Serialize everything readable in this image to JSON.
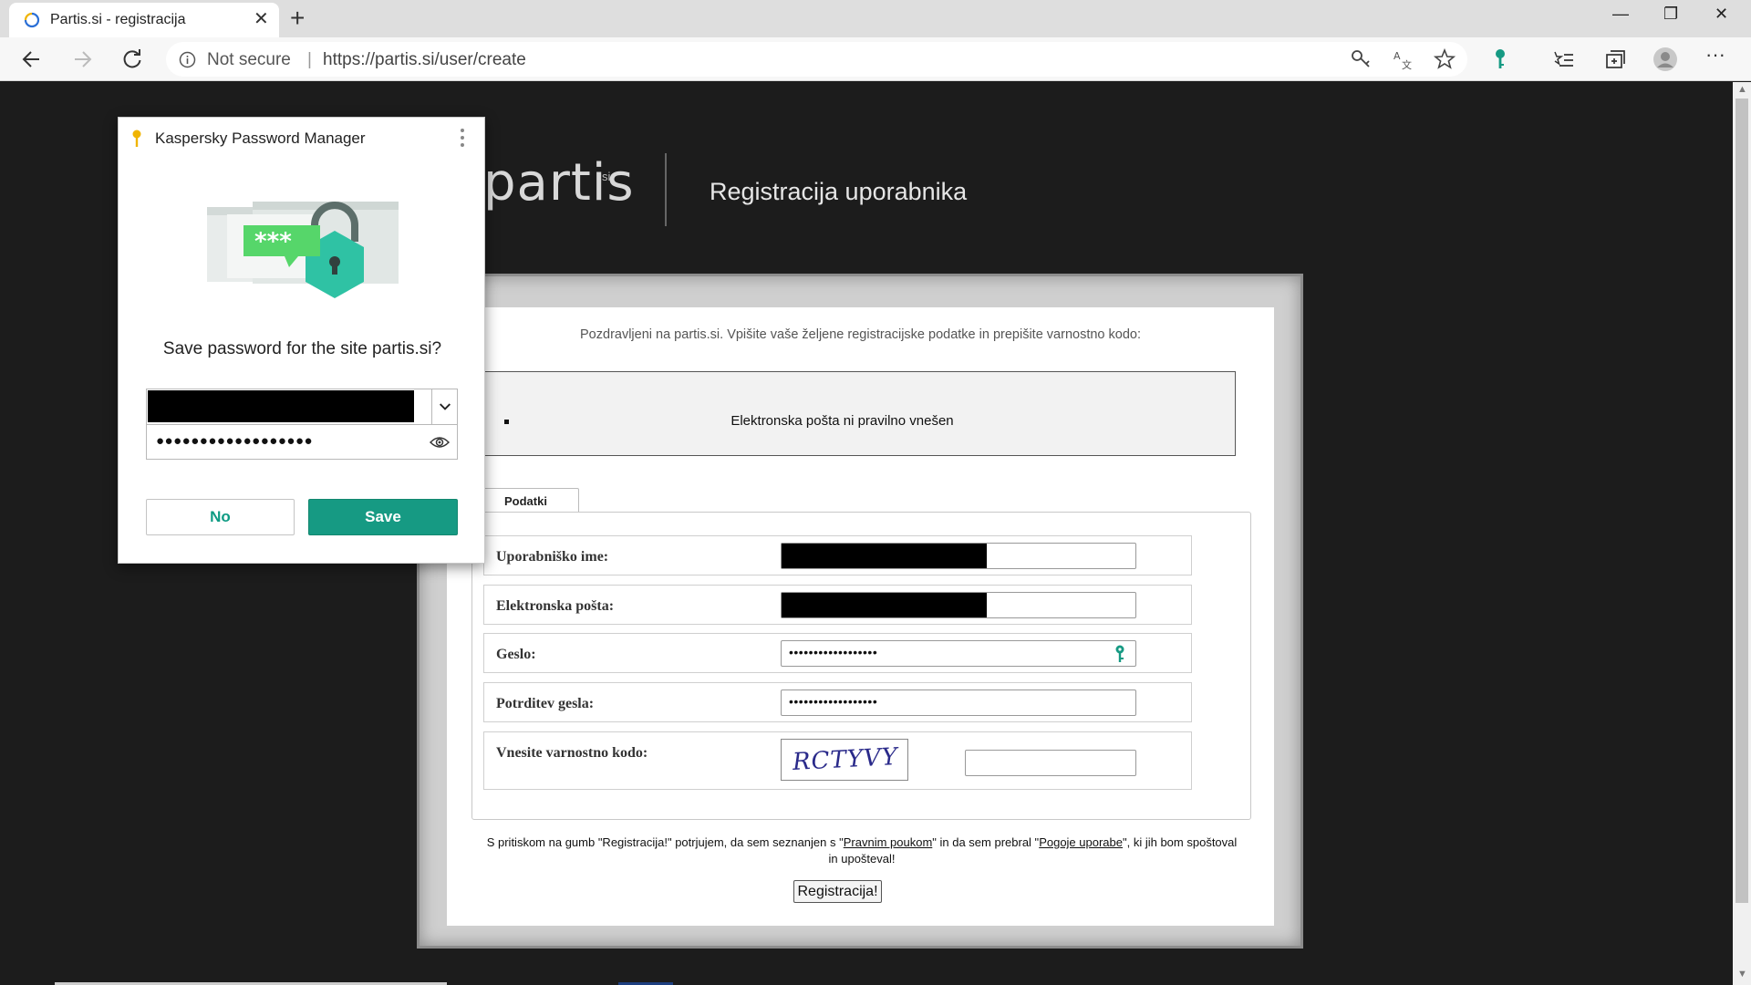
{
  "browser": {
    "tab_title": "Partis.si - registracija",
    "tab_close": "✕",
    "new_tab": "+",
    "window_minimize": "—",
    "window_restore": "❐",
    "window_close": "✕",
    "not_secure": "Not secure",
    "separator": "|",
    "url": "https://partis.si/user/create",
    "more_menu": "···"
  },
  "header": {
    "logo": "partis",
    "logo_suffix": "si",
    "title": "Registracija uporabnika"
  },
  "form": {
    "welcome": "Pozdravljeni na partis.si. Vpišite vaše željene registracijske podatke in prepišite varnostno kodo:",
    "error": "Elektronska pošta ni pravilno vnešen",
    "tab": "Podatki",
    "fields": [
      {
        "label": "Uporabniško ime:"
      },
      {
        "label": "Elektronska pošta:"
      },
      {
        "label": "Geslo:",
        "value": "••••••••••••••••••"
      },
      {
        "label": "Potrditev gesla:",
        "value": "••••••••••••••••••"
      },
      {
        "label": "Vnesite varnostno kodo:"
      }
    ],
    "captcha": "RCTYVY",
    "terms_pre": "S pritiskom na gumb \"Registracija!\" potrjujem, da sem seznanjen s \"",
    "terms_link1": "Pravnim poukom",
    "terms_mid": "\" in da sem prebral \"",
    "terms_link2": "Pogoje uporabe",
    "terms_post": "\", ki jih bom spoštoval in upošteval!",
    "submit": "Registracija!"
  },
  "kaspersky": {
    "title": "Kaspersky Password Manager",
    "question": "Save password for the site partis.si?",
    "password_dots": "●●●●●●●●●●●●●●●●●●",
    "illustration_stars": "***",
    "no": "No",
    "save": "Save"
  },
  "colors": {
    "kaspersky_green": "#169a83",
    "page_background": "#1c1c1c"
  }
}
